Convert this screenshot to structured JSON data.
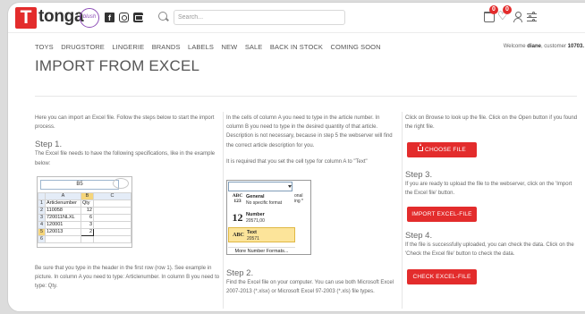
{
  "header": {
    "logo_letter": "T",
    "logo_word": "tonga",
    "logo_blush": "blush",
    "search_placeholder": "Search...",
    "cart_count": "0",
    "wishlist_count": "0"
  },
  "nav": {
    "items": [
      "TOYS",
      "DRUGSTORE",
      "LINGERIE",
      "BRANDS",
      "LABELS",
      "NEW",
      "SALE",
      "BACK IN STOCK",
      "COMING SOON"
    ],
    "welcome_prefix": "Welcome ",
    "welcome_name": "diane",
    "welcome_mid": ", customer ",
    "customer_number": "10703."
  },
  "page_title": "IMPORT FROM EXCEL",
  "col1": {
    "intro": "Here you can import an Excel file. Follow the steps below to start the import process.",
    "step1_title": "Step 1.",
    "step1_text": "The Excel file needs to have the following specifications, like in the example below:",
    "bottom_text": "Be sure that you type in the header in the first row (row 1). See example in picture. In column A you need to type: Articlenumber. In column B you need to type: Qty."
  },
  "excel": {
    "cell_ref": "B5",
    "columns": [
      "",
      "A",
      "B",
      "C"
    ],
    "rows": [
      [
        "1",
        "Articlenumber",
        "Qty",
        ""
      ],
      [
        "2",
        "110058",
        "12",
        ""
      ],
      [
        "3",
        "720011NLXL",
        "6",
        ""
      ],
      [
        "4",
        "120001",
        "3",
        ""
      ],
      [
        "5",
        "120013",
        "2",
        ""
      ],
      [
        "6",
        "",
        "",
        ""
      ]
    ]
  },
  "col2": {
    "text1": "In the cells of column A you need to type in the article number. In column B you need to type in the desired quantity of that article. Description is not necessary, because in step 5 the webserver will find the correct article description for you.",
    "text2": "It is required that you set the cell type for column A to \"Text\"",
    "step2_title": "Step 2.",
    "step2_text": "Find the Excel file on your computer. You can use both Microsoft Excel 2007-2013 (*.xlsx) or Microsoft Excel 97-2003 (*.xls) file types."
  },
  "format_menu": {
    "side_line1": "onal",
    "side_line2": "ing *",
    "items": [
      {
        "glyph": "ABC\n123",
        "name": "General",
        "sub": "No specific format"
      },
      {
        "glyph": "12",
        "name": "Number",
        "sub": "20571,00"
      },
      {
        "glyph": "ABC",
        "name": "Text",
        "sub": "20571"
      }
    ],
    "more_label": "More Number Formats..."
  },
  "col3": {
    "intro": "Click on Browse to look up the file. Click on the Open button if you found the right file.",
    "choose_button": "CHOOSE FILE",
    "step3_title": "Step 3.",
    "step3_text": "If you are ready to upload the file to the webserver, click on the 'Import the Excel file' button.",
    "import_button": "IMPORT EXCEL-FILE",
    "step4_title": "Step 4.",
    "step4_text": "If the file is successfully uploaded, you can check the data. Click on the 'Check the Excel file' button to check the data.",
    "check_button": "CHECK EXCEL-FILE"
  },
  "colors": {
    "accent": "#e32c2c",
    "brand_purple": "#8e4fb8",
    "highlight": "#fce49a"
  }
}
